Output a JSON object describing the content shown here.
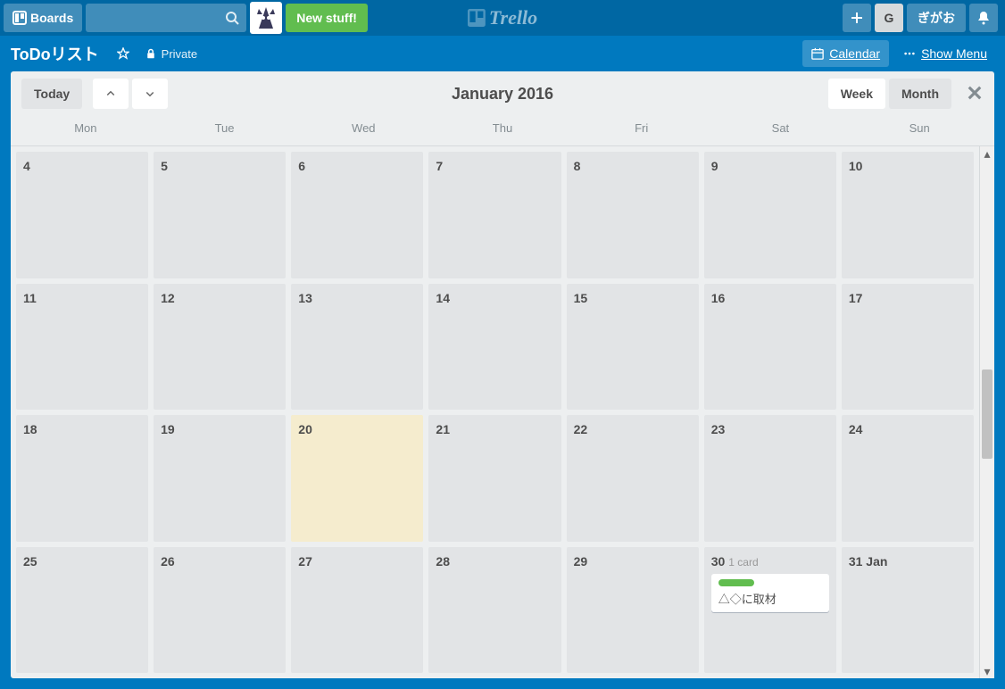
{
  "header": {
    "boards_label": "Boards",
    "new_stuff": "New stuff!",
    "logo_text": "Trello",
    "user_initial": "G",
    "user_name": "ぎがお"
  },
  "board": {
    "name": "ToDoリスト",
    "visibility": "Private",
    "calendar_label": "Calendar",
    "show_menu": "Show Menu"
  },
  "calendar": {
    "today_label": "Today",
    "title": "January 2016",
    "week_label": "Week",
    "month_label": "Month",
    "dow": [
      "Mon",
      "Tue",
      "Wed",
      "Thu",
      "Fri",
      "Sat",
      "Sun"
    ],
    "weeks": [
      [
        {
          "d": "4"
        },
        {
          "d": "5"
        },
        {
          "d": "6"
        },
        {
          "d": "7"
        },
        {
          "d": "8"
        },
        {
          "d": "9"
        },
        {
          "d": "10"
        }
      ],
      [
        {
          "d": "11"
        },
        {
          "d": "12"
        },
        {
          "d": "13"
        },
        {
          "d": "14"
        },
        {
          "d": "15"
        },
        {
          "d": "16"
        },
        {
          "d": "17"
        }
      ],
      [
        {
          "d": "18"
        },
        {
          "d": "19"
        },
        {
          "d": "20",
          "today": true
        },
        {
          "d": "21"
        },
        {
          "d": "22"
        },
        {
          "d": "23"
        },
        {
          "d": "24"
        }
      ],
      [
        {
          "d": "25"
        },
        {
          "d": "26"
        },
        {
          "d": "27"
        },
        {
          "d": "28"
        },
        {
          "d": "29"
        },
        {
          "d": "30",
          "count": "1 card",
          "cards": [
            {
              "label_color": "#61bd4f",
              "title": "△◇に取材"
            }
          ]
        },
        {
          "d": "31 Jan"
        }
      ]
    ]
  }
}
